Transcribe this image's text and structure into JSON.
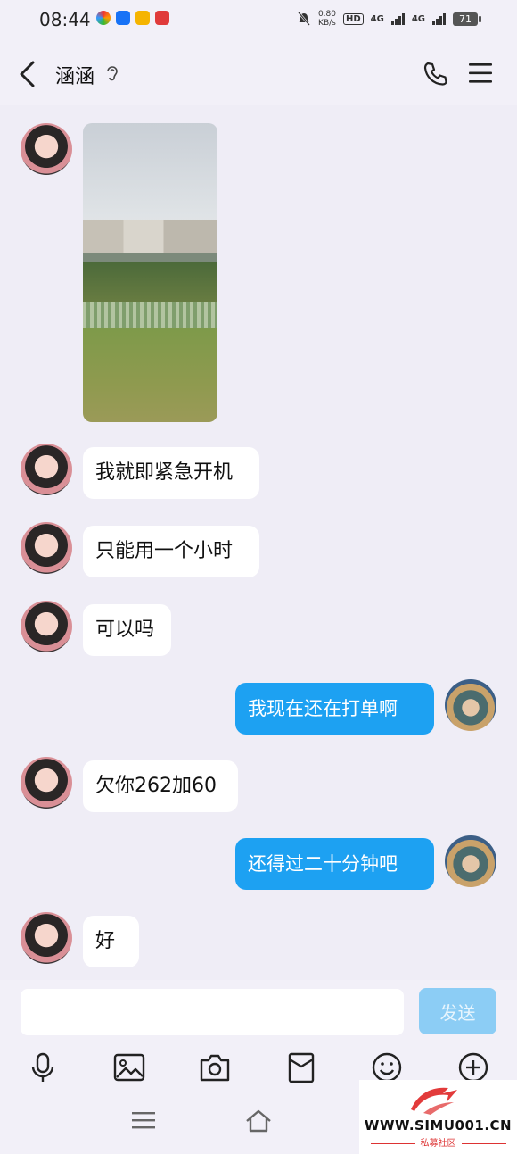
{
  "status_bar": {
    "time": "08:44",
    "net_speed_value": "0.80",
    "net_speed_unit": "KB/s",
    "hd_label": "HD",
    "sim1_label": "4G",
    "sim2_label": "4G",
    "battery": "71"
  },
  "header": {
    "title": "涵涵"
  },
  "messages": [
    {
      "sender": "them",
      "type": "image"
    },
    {
      "sender": "them",
      "type": "text",
      "text": "我就即紧急开机"
    },
    {
      "sender": "them",
      "type": "text",
      "text": "只能用一个小时"
    },
    {
      "sender": "them",
      "type": "text",
      "text": "可以吗"
    },
    {
      "sender": "me",
      "type": "text",
      "text": "我现在还在打单啊"
    },
    {
      "sender": "them",
      "type": "text",
      "text": "欠你262加60"
    },
    {
      "sender": "me",
      "type": "text",
      "text": "还得过二十分钟吧"
    },
    {
      "sender": "them",
      "type": "text",
      "text": "好"
    }
  ],
  "composer": {
    "input_value": "",
    "send_label": "发送"
  },
  "watermark": {
    "site": "WWW.SIMU001.CN",
    "subtitle": "私募社区"
  },
  "colors": {
    "background": "#efedf6",
    "bubble_me": "#1da1f2",
    "bubble_them": "#ffffff",
    "send_button": "#8ccdf5"
  }
}
